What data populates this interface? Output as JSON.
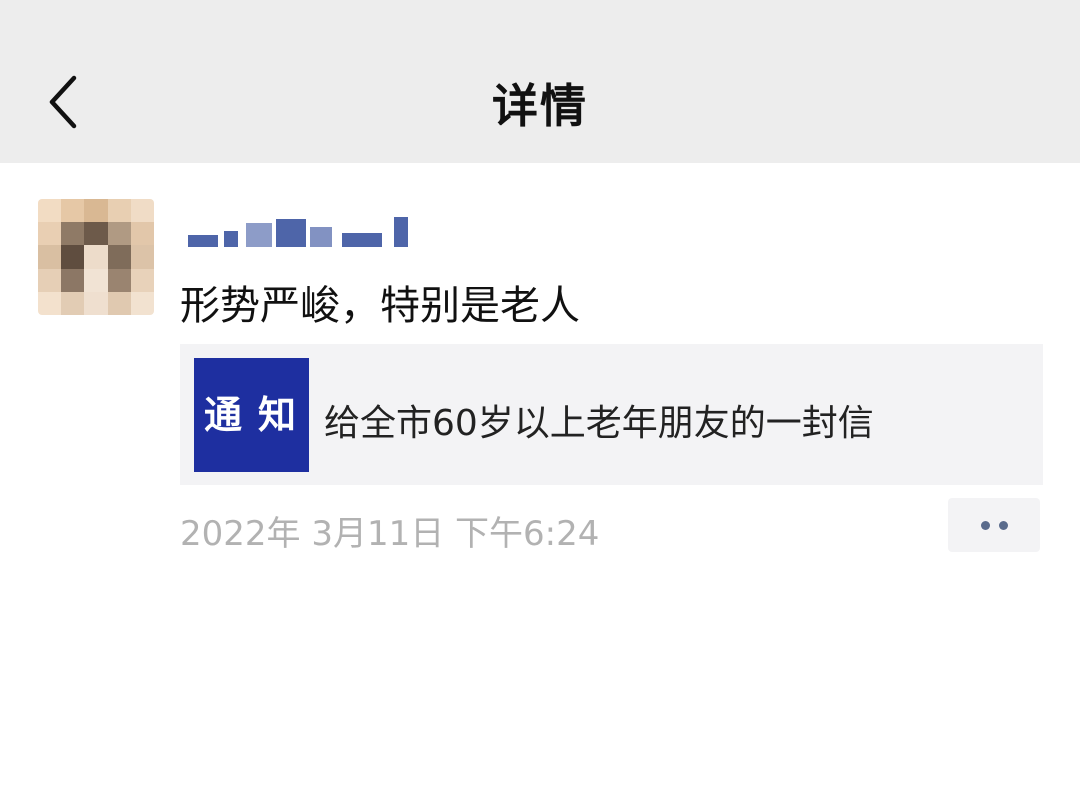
{
  "header": {
    "title": "详情",
    "back_icon": "chevron-left-icon",
    "background": "#ededed"
  },
  "post": {
    "avatar_icon": "avatar-blurred",
    "text": "形势严峻，特别是老人",
    "share_card": {
      "thumbnail_text": "通知",
      "thumbnail_color": "#1e2fa0",
      "title": "给全市60岁以上老年朋友的一封信"
    },
    "timestamp": "2022年 3月11日 下午6:24",
    "more_icon": "more-dots-icon"
  }
}
